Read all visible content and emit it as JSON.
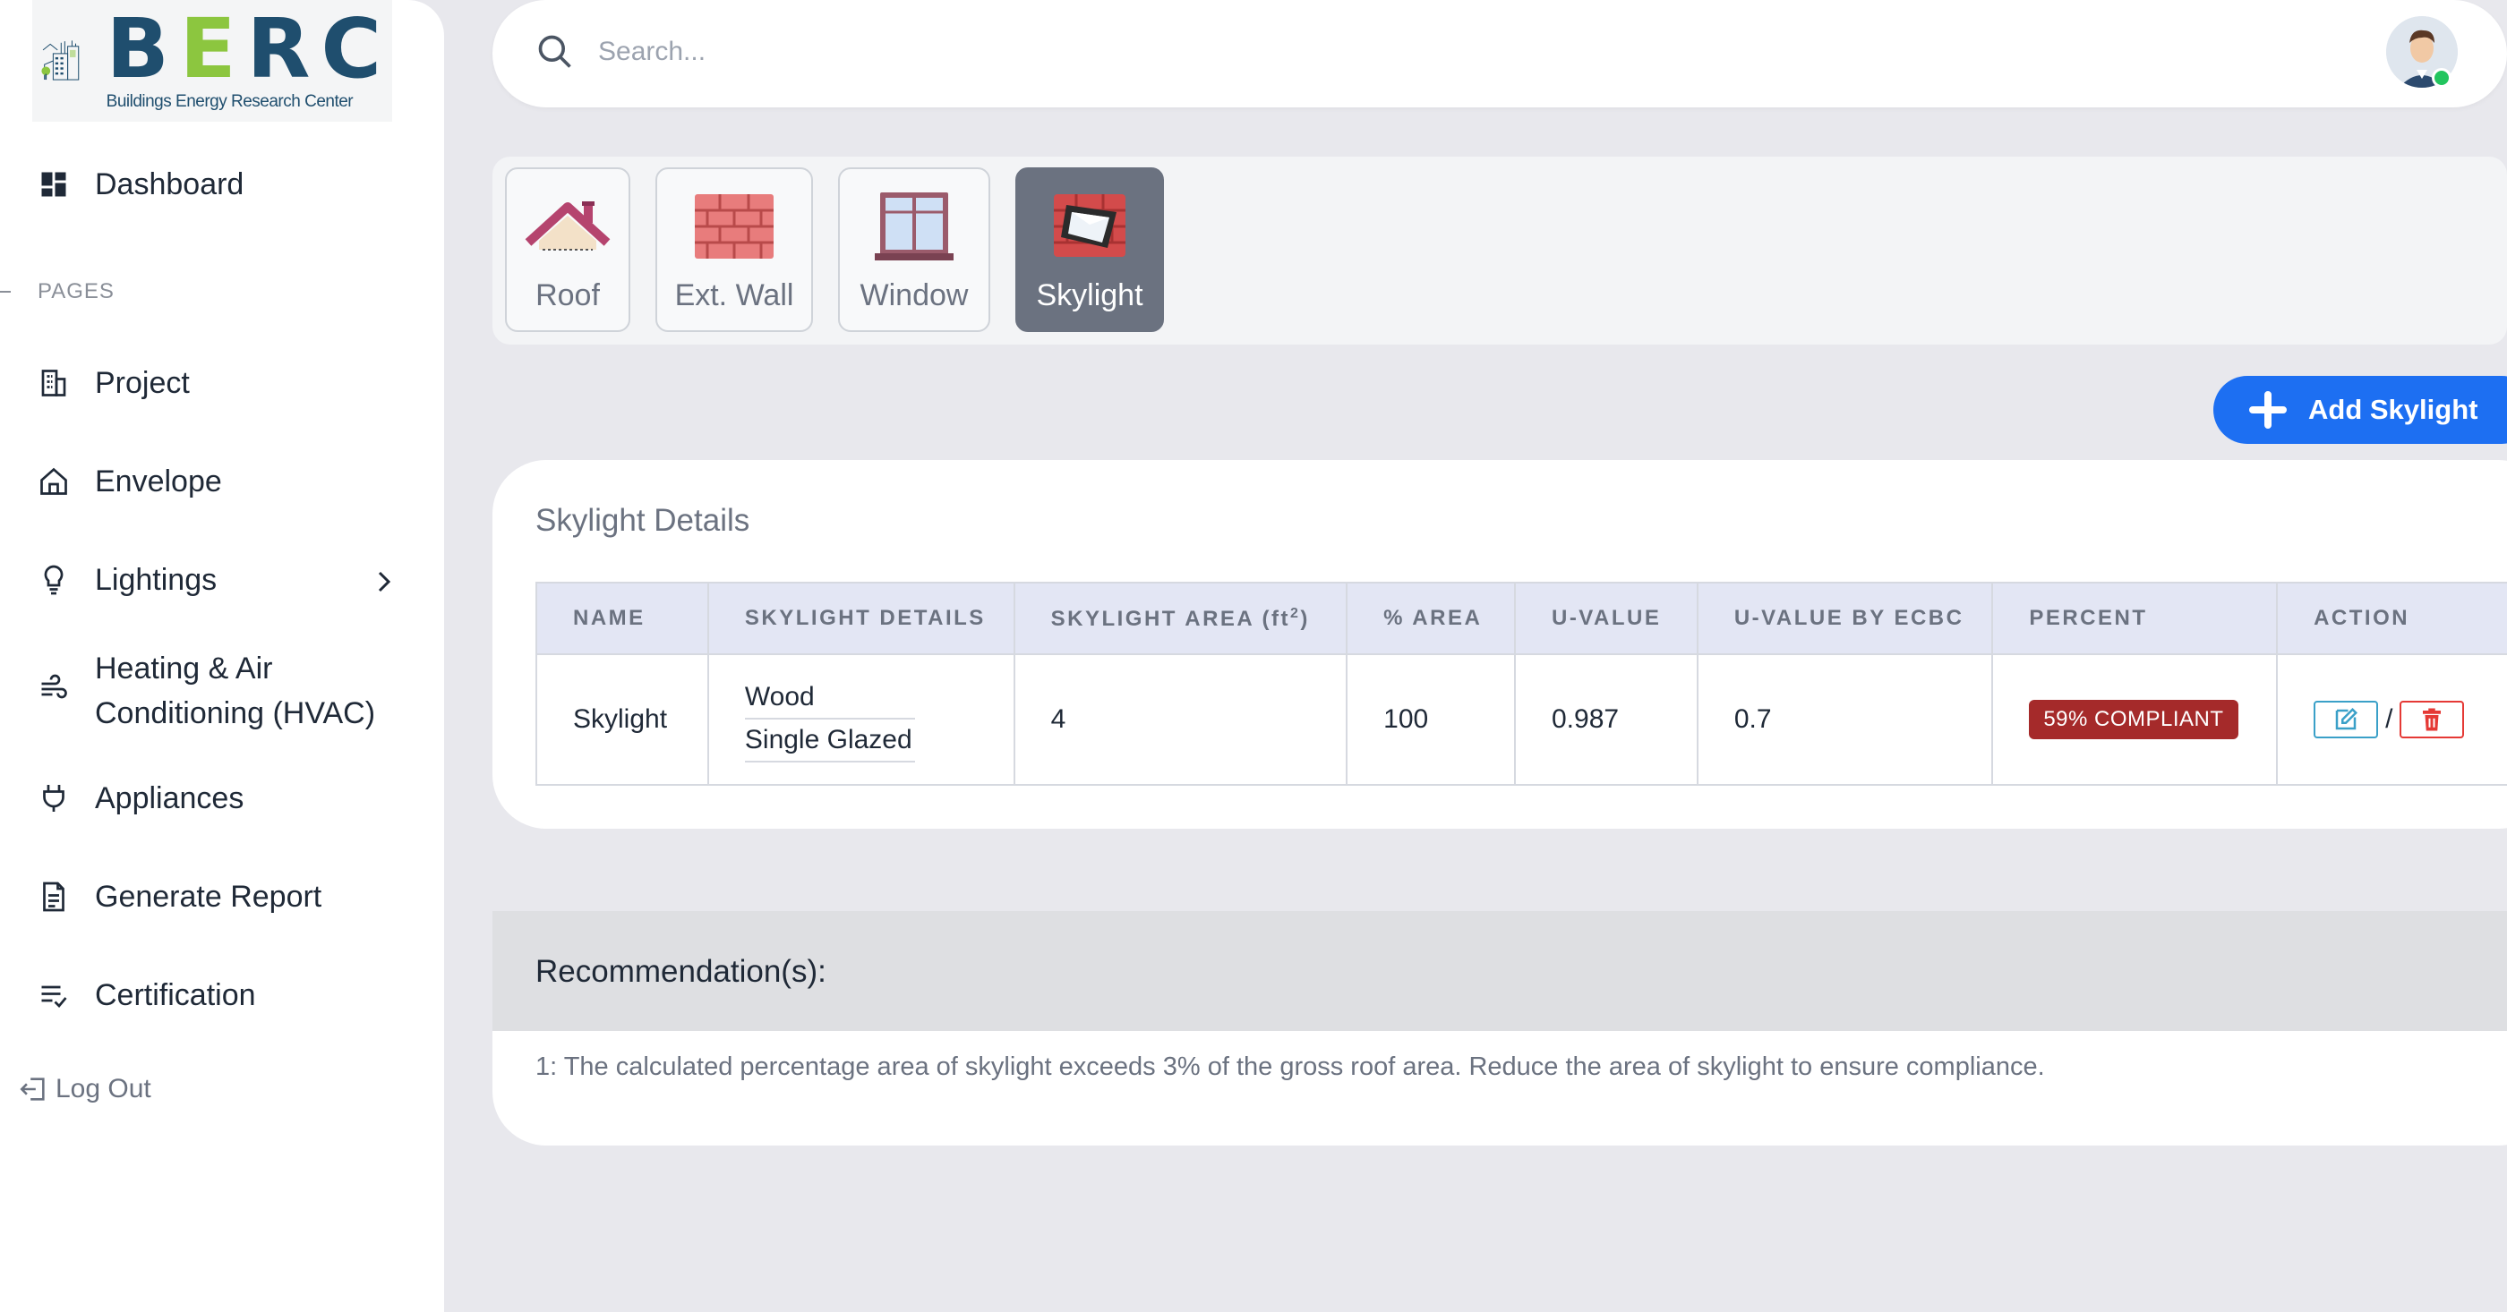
{
  "brand": {
    "logo_word": "BERC",
    "logo_subtitle": "Buildings Energy Research Center",
    "logo_icon": "building-icon"
  },
  "sidebar": {
    "section_label": "PAGES",
    "items": [
      {
        "label": "Dashboard",
        "icon": "dashboard-icon"
      },
      {
        "label": "Project",
        "icon": "building-icon"
      },
      {
        "label": "Envelope",
        "icon": "home-icon"
      },
      {
        "label": "Lightings",
        "icon": "bulb-icon"
      },
      {
        "label": "Heating & Air",
        "label2": "Conditioning (HVAC)",
        "icon": "wind-icon"
      },
      {
        "label": "Appliances",
        "icon": "plug-icon"
      },
      {
        "label": "Generate Report",
        "icon": "document-icon"
      },
      {
        "label": "Certification",
        "icon": "checklist-icon"
      }
    ],
    "logout_label": "Log Out"
  },
  "search": {
    "placeholder": "Search..."
  },
  "tabs": [
    {
      "label": "Roof",
      "icon": "roof-icon",
      "active": false
    },
    {
      "label": "Ext. Wall",
      "icon": "brick-wall-icon",
      "active": false
    },
    {
      "label": "Window",
      "icon": "window-icon",
      "active": false
    },
    {
      "label": "Skylight",
      "icon": "skylight-icon",
      "active": true
    }
  ],
  "add_button": {
    "label": "Add Skylight"
  },
  "details": {
    "title": "Skylight Details",
    "columns": [
      "NAME",
      "SKYLIGHT DETAILS",
      "SKYLIGHT AREA (ft",
      "% AREA",
      "U-VALUE",
      "U-VALUE BY ECBC",
      "PERCENT",
      "ACTION"
    ],
    "area_sup": "2",
    "area_close": ")",
    "rows": [
      {
        "name": "Skylight",
        "detail_1": "Wood",
        "detail_2": "Single Glazed",
        "area": "4",
        "pct_area": "100",
        "u_value": "0.987",
        "u_value_ecbc": "0.7",
        "percent_badge": "59% COMPLIANT",
        "action_separator": "/"
      }
    ]
  },
  "recommendation": {
    "title": "Recommendation(s):",
    "text": "1: The calculated percentage area of skylight exceeds 3% of the gross roof area. Reduce the area of skylight to ensure compliance."
  },
  "colors": {
    "accent": "#1d6ff2",
    "brand_dark": "#1f4e6e",
    "brand_green": "#8cc63f",
    "badge_red": "#a52a2a",
    "active_tab": "#6b7280"
  }
}
